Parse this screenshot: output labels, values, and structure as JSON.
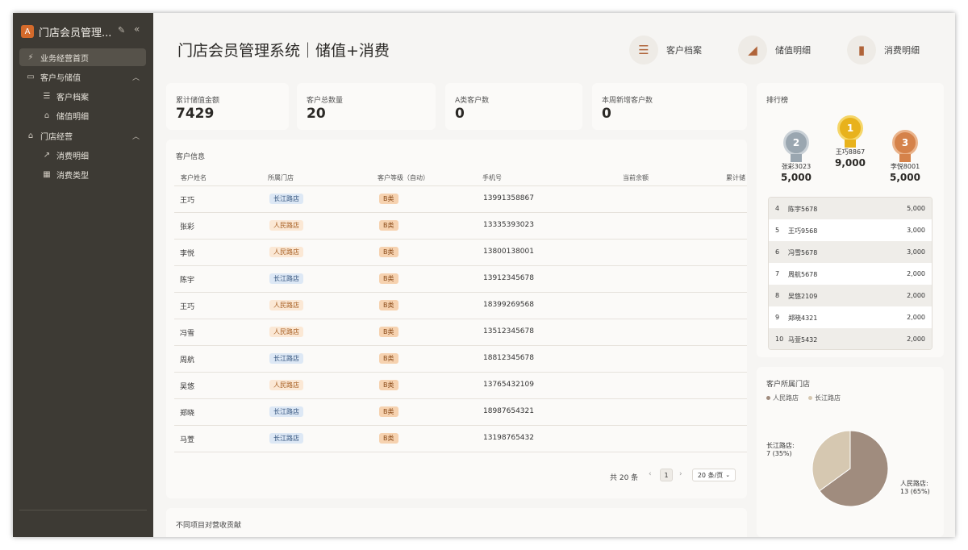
{
  "sidebar": {
    "title": "门店会员管理...",
    "logo_glyph": "A",
    "items": [
      {
        "label": "业务经营首页",
        "icon": "lightning-icon",
        "glyph": "⚡"
      },
      {
        "label": "客户与储值",
        "icon": "monitor-icon",
        "glyph": "▭"
      },
      {
        "label": "客户档案",
        "icon": "database-icon",
        "glyph": "☰"
      },
      {
        "label": "储值明细",
        "icon": "chart-area-icon",
        "glyph": "⌂"
      },
      {
        "label": "门店经营",
        "icon": "shop-icon",
        "glyph": "⌂"
      },
      {
        "label": "消费明细",
        "icon": "trend-icon",
        "glyph": "↗"
      },
      {
        "label": "消费类型",
        "icon": "grid-icon",
        "glyph": "▦"
      }
    ]
  },
  "header": {
    "title": "门店会员管理系统｜储值+消费",
    "buttons": [
      {
        "label": "客户档案",
        "icon": "database-icon",
        "glyph": "☰"
      },
      {
        "label": "储值明细",
        "icon": "area-chart-icon",
        "glyph": "◢"
      },
      {
        "label": "消费明细",
        "icon": "bar-chart-icon",
        "glyph": "▮"
      }
    ]
  },
  "stats": [
    {
      "label": "累计储值金额",
      "value": "7429"
    },
    {
      "label": "客户总数量",
      "value": "20"
    },
    {
      "label": "A类客户数",
      "value": "0"
    },
    {
      "label": "本周新增客户数",
      "value": "0"
    }
  ],
  "customers": {
    "title": "客户信息",
    "columns": [
      "客户姓名",
      "所属门店",
      "客户等级（自动）",
      "手机号",
      "当前余额",
      "累计储"
    ],
    "rows": [
      {
        "name": "王巧",
        "store": "长江路店",
        "store_color": "blue",
        "level": "B类",
        "phone": "13991358867"
      },
      {
        "name": "张彩",
        "store": "人民路店",
        "store_color": "orange",
        "level": "B类",
        "phone": "13335393023"
      },
      {
        "name": "李悦",
        "store": "人民路店",
        "store_color": "orange",
        "level": "B类",
        "phone": "13800138001"
      },
      {
        "name": "陈宇",
        "store": "长江路店",
        "store_color": "blue",
        "level": "B类",
        "phone": "13912345678"
      },
      {
        "name": "王巧",
        "store": "人民路店",
        "store_color": "orange",
        "level": "B类",
        "phone": "18399269568"
      },
      {
        "name": "冯雪",
        "store": "人民路店",
        "store_color": "orange",
        "level": "B类",
        "phone": "13512345678"
      },
      {
        "name": "周航",
        "store": "长江路店",
        "store_color": "blue",
        "level": "B类",
        "phone": "18812345678"
      },
      {
        "name": "吴悠",
        "store": "人民路店",
        "store_color": "orange",
        "level": "B类",
        "phone": "13765432109"
      },
      {
        "name": "郑晓",
        "store": "长江路店",
        "store_color": "blue",
        "level": "B类",
        "phone": "18987654321"
      },
      {
        "name": "马萱",
        "store": "长江路店",
        "store_color": "blue",
        "level": "B类",
        "phone": "13198765432"
      }
    ],
    "pager": {
      "total": "共 20 条",
      "page": "1",
      "page_size": "20 条/页"
    }
  },
  "revenue": {
    "title": "不同项目对营收贡献"
  },
  "ranking": {
    "title": "排行榜",
    "top3": [
      {
        "rank": "2",
        "name": "张彩3023",
        "value": "5,000",
        "color": "#9aa6b0"
      },
      {
        "rank": "1",
        "name": "王巧8867",
        "value": "9,000",
        "color": "#e8b21c"
      },
      {
        "rank": "3",
        "name": "李悦8001",
        "value": "5,000",
        "color": "#d5824a"
      }
    ],
    "rest": [
      {
        "rank": "4",
        "name": "陈宇5678",
        "value": "5,000"
      },
      {
        "rank": "5",
        "name": "王巧9568",
        "value": "3,000"
      },
      {
        "rank": "6",
        "name": "冯雪5678",
        "value": "3,000"
      },
      {
        "rank": "7",
        "name": "周航5678",
        "value": "2,000"
      },
      {
        "rank": "8",
        "name": "吴悠2109",
        "value": "2,000"
      },
      {
        "rank": "9",
        "name": "郑晓4321",
        "value": "2,000"
      },
      {
        "rank": "10",
        "name": "马萱5432",
        "value": "2,000"
      }
    ]
  },
  "store_share": {
    "title": "客户所属门店",
    "legend": [
      "人民路店",
      "长江路店"
    ],
    "label_changjiang_1": "长江路店:",
    "label_changjiang_2": "7 (35%)",
    "label_renmin_1": "人民路店:",
    "label_renmin_2": "13 (65%)"
  },
  "chart_data": {
    "type": "pie",
    "categories": [
      "人民路店",
      "长江路店"
    ],
    "values": [
      13,
      7
    ],
    "percent": [
      65,
      35
    ],
    "colors": [
      "#a08c7e",
      "#d6c8b1"
    ],
    "legend": "top-left"
  }
}
